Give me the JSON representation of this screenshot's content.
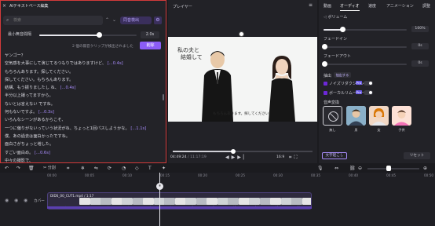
{
  "left_panel": {
    "title": "AIテキストベース編集",
    "close_icon": "×",
    "search_placeholder": "検索",
    "filter_label": "同音検出",
    "min_pause_label": "最小無音間隔",
    "min_pause_value": "2.0s",
    "min_pause_fraction": 0.62,
    "clips_note": "2 個の無音クリップが検出されました",
    "delete_label": "削除",
    "transcript": [
      {
        "text": "ヤンゴー？",
        "pause": ""
      },
      {
        "text": "空気感を大事にして演じてるつもりではありますけど、",
        "pause": "[...0.4s]"
      },
      {
        "text": "もちろんあります。探してください。",
        "pause": ""
      },
      {
        "text": "探してください。もちろんあります。",
        "pause": ""
      },
      {
        "text": "結構、もう振りましたし ね、",
        "pause": "[...0.4s]"
      },
      {
        "text": "半分以上撮ってますから。",
        "pause": ""
      },
      {
        "text": "ないとは言えない ですね。",
        "pause": ""
      },
      {
        "text": "何もないですよ。",
        "pause": "[...0.3s]"
      },
      {
        "text": "いろんなシーンがあるからこそ、",
        "pause": ""
      },
      {
        "text": "一つに偏りがないっていう状況がね、ちょっと1回パスしようかな。",
        "pause": "[...1.1s]"
      },
      {
        "text": "僕、あの過去は面白かったですね。",
        "pause": ""
      },
      {
        "text": "面白さがちょっと増した。",
        "pause": ""
      },
      {
        "text": "すごい面白め。",
        "pause": "[...0.6s]"
      },
      {
        "text": "中々の撮影で、",
        "pause": ""
      }
    ]
  },
  "player": {
    "title": "プレイヤー",
    "video_title_line1": "私の夫と",
    "video_title_line2": "結婚して",
    "caption": "もちろんあります。探してください。",
    "time_current": "04:49:24",
    "time_total": "11:17:19",
    "progress_fraction": 0.43,
    "ratio": "16:9"
  },
  "right_panel": {
    "tabs": [
      "動画",
      "オーディオ",
      "速度",
      "アニメーション",
      "調整"
    ],
    "active_tab": 1,
    "volume_label": "ボリューム",
    "volume_value": "100%",
    "volume_fraction": 0.23,
    "fadein_label": "フェードイン",
    "fadein_value": "0s",
    "fadeout_label": "フェードアウト",
    "fadeout_value": "0s",
    "normalize_label": "抽出",
    "normalize_value": "抽出する",
    "noise_label": "ノイズリダクション",
    "vocal_label": "ボーカルリムーバー",
    "badge": "Pro",
    "voice_change_label": "音声変換",
    "presets": [
      "無し",
      "男",
      "女",
      "子供"
    ],
    "lang_button": "文字起こし",
    "reset_button": "リセット"
  },
  "toolbar": {
    "split_label": "分割"
  },
  "timeline": {
    "ticks": [
      "00:00",
      "00:05",
      "00:10",
      "00:15",
      "00:20",
      "00:25",
      "00:30",
      "00:35",
      "00:40",
      "00:45",
      "00:50"
    ],
    "track_label": "カバー",
    "clip_label": "DIDS_00_CUT1.mp4 / 1:17"
  },
  "colors": {
    "accent": "#8b5cf6",
    "highlight_border": "#d23a3a",
    "panel": "#222227",
    "clip_bar": "#5b3fb0"
  }
}
